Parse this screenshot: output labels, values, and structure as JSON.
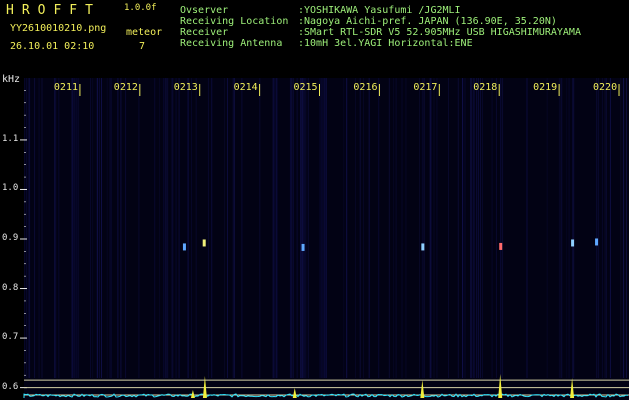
{
  "header": {
    "app_title": "HROFFT",
    "version": "1.0.0f",
    "file_name": "YY2610010210.png",
    "timestamp": "26.10.01 02:10",
    "meteor_label": "meteor",
    "meteor_count": "7"
  },
  "station_info": [
    {
      "key": "Ovserver",
      "value": ":YOSHIKAWA Yasufumi /JG2MLI"
    },
    {
      "key": "Receiving Location",
      "value": ":Nagoya Aichi-pref. JAPAN (136.90E, 35.20N)"
    },
    {
      "key": "Receiver",
      "value": ":SMart RTL-SDR V5 52.905MHz USB HIGASHIMURAYAMA"
    },
    {
      "key": "Receiving Antenna",
      "value": ":10mH 3el.YAGI Horizontal:ENE"
    }
  ],
  "chart_data": {
    "type": "heatmap",
    "ylabel": "kHz",
    "y_ticks": [
      "1.1",
      "1.0",
      "0.9",
      "0.8",
      "0.7",
      "0.6"
    ],
    "y_tick_values": [
      1.1,
      1.0,
      0.9,
      0.8,
      0.7,
      0.6
    ],
    "ylim": [
      0.575,
      1.225
    ],
    "x_ticks": [
      "0211",
      "0212",
      "0213",
      "0214",
      "0215",
      "0216",
      "0217",
      "0218",
      "0219",
      "0220"
    ],
    "x_tick_values": [
      211,
      212,
      213,
      214,
      215,
      216,
      217,
      218,
      219,
      220
    ],
    "xlim": [
      210.1,
      220.2
    ],
    "meteors": [
      {
        "t": 212.77,
        "f": 0.885,
        "color": "#5fa8ff"
      },
      {
        "t": 213.1,
        "f": 0.893,
        "color": "#f0f07a"
      },
      {
        "t": 214.75,
        "f": 0.884,
        "color": "#5fa8ff"
      },
      {
        "t": 216.75,
        "f": 0.885,
        "color": "#8fd0ff"
      },
      {
        "t": 218.05,
        "f": 0.886,
        "color": "#ff6a6a"
      },
      {
        "t": 219.25,
        "f": 0.893,
        "color": "#8fd0ff"
      },
      {
        "t": 219.65,
        "f": 0.895,
        "color": "#5fa8ff"
      }
    ],
    "peaks": [
      {
        "t": 212.92,
        "h": 0.2
      },
      {
        "t": 213.12,
        "h": 0.55
      },
      {
        "t": 214.62,
        "h": 0.25
      },
      {
        "t": 216.75,
        "h": 0.45
      },
      {
        "t": 218.05,
        "h": 0.6
      },
      {
        "t": 219.25,
        "h": 0.5
      }
    ],
    "reference_lines": [
      0.615,
      0.6,
      0.585
    ],
    "colors": {
      "tick": "#e6e6e6",
      "time_label": "#f2ef5a",
      "reference_line": "#d6d3a6",
      "spectrum": "#32e6ff",
      "peak": "#f2ef3a"
    }
  }
}
